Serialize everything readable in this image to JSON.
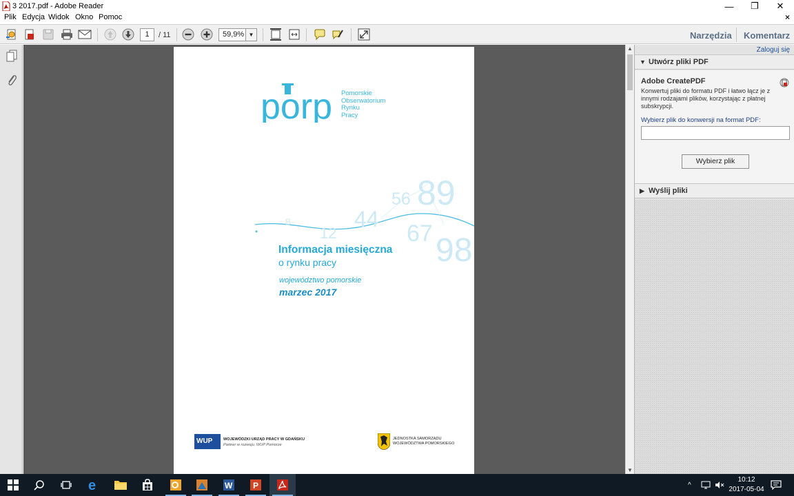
{
  "window": {
    "title": "3 2017.pdf - Adobe Reader",
    "minimize": "—",
    "restore": "❐",
    "close": "✕"
  },
  "menu": {
    "items": [
      "Plik",
      "Edycja",
      "Widok",
      "Okno",
      "Pomoc"
    ],
    "close_doc": "×"
  },
  "toolbar": {
    "page_current": "1",
    "page_total": "/ 11",
    "zoom": "59,9%",
    "tools_label": "Narzędzia",
    "comment_label": "Komentarz"
  },
  "document": {
    "logo_word": "porp",
    "logo_text": [
      "Pomorskie",
      "Obserwatorium",
      "Rynku",
      "Pracy"
    ],
    "numbers": [
      "89",
      "56",
      "44",
      "67",
      "98",
      "12",
      "8"
    ],
    "title": "Informacja miesięczna",
    "subtitle": "o rynku pracy",
    "region": "województwo pomorskie",
    "month": "marzec 2017",
    "footer_left_badge": "WUP",
    "footer_left_line1": "WOJEWÓDZKI URZĄD PRACY W GDAŃSKU",
    "footer_left_line2": "Partner w rozwoju. WUP Pomorze",
    "footer_right_line1": "JEDNOSTKA SAMORZĄDU",
    "footer_right_line2": "WOJEWÓDZTWA POMORSKIEGO"
  },
  "right_pane": {
    "sign_in": "Zaloguj się",
    "create_section": "Utwórz pliki PDF",
    "create_pdf_title": "Adobe CreatePDF",
    "create_pdf_desc": "Konwertuj pliki do formatu PDF i łatwo łącz je z innymi rodzajami plików, korzystając z płatnej subskrypcji.",
    "choose_label": "Wybierz plik do konwersji na format PDF:",
    "choose_button": "Wybierz plik",
    "send_section": "Wyślij pliki"
  },
  "taskbar": {
    "time": "10:12",
    "date": "2017-05-04"
  },
  "colors": {
    "accent": "#25a9d6",
    "taskbar": "#101a24",
    "doc_bg": "#5b5b5b"
  }
}
